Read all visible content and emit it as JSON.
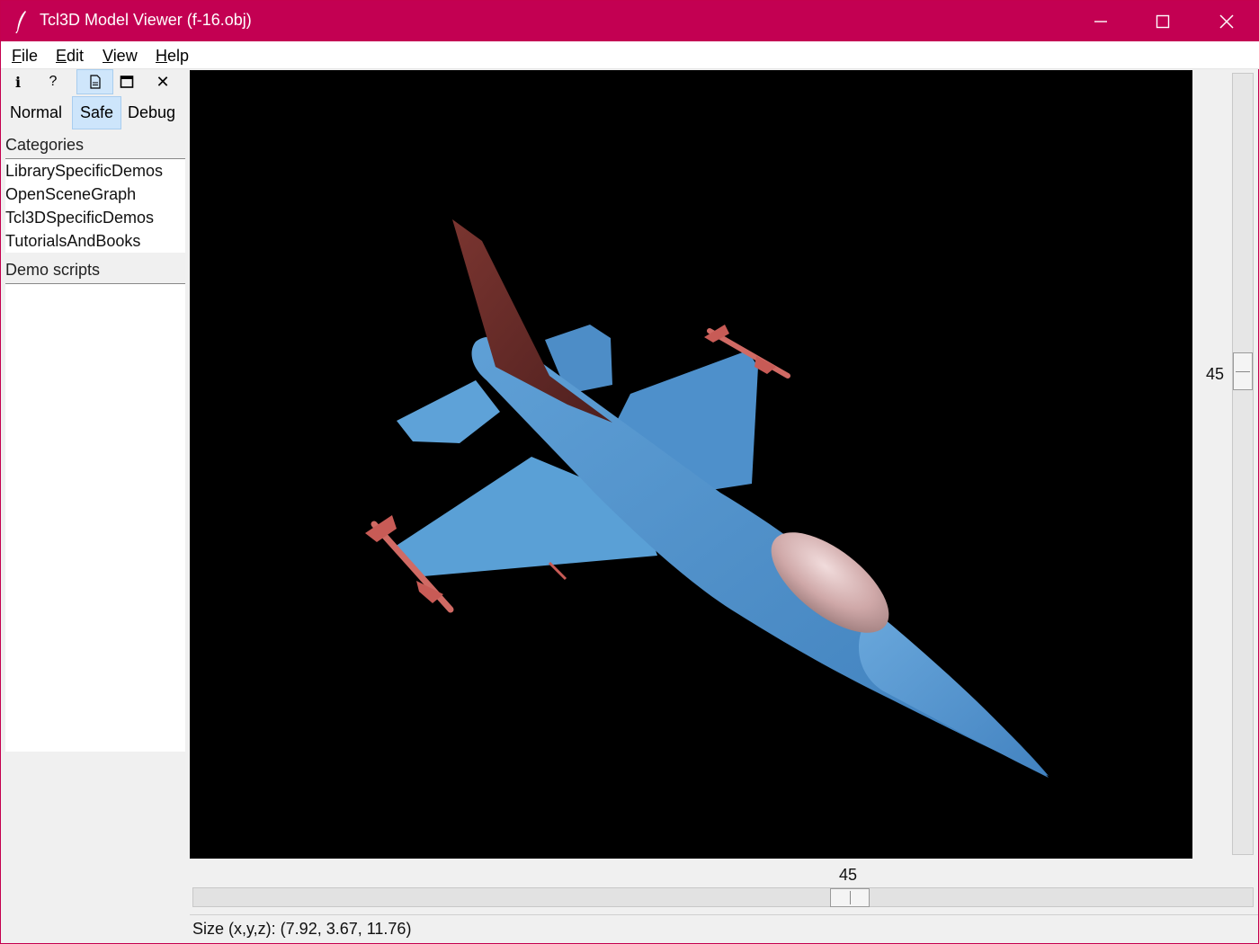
{
  "window": {
    "title": "Tcl3D Model Viewer (f-16.obj)",
    "titlebar_color": "#c30052"
  },
  "menu": [
    {
      "label": "File"
    },
    {
      "label": "Edit"
    },
    {
      "label": "View"
    },
    {
      "label": "Help"
    }
  ],
  "toolbar": {
    "icons": [
      "info-icon",
      "help-icon",
      "document-icon",
      "maximize-view-icon",
      "close-icon"
    ],
    "info_glyph": "i",
    "help_glyph": "?",
    "close_glyph": "✕"
  },
  "modes": [
    "Normal",
    "Safe",
    "Debug"
  ],
  "active_mode": "Safe",
  "categories_header": "Categories",
  "categories": [
    "LibrarySpecificDemos",
    "OpenSceneGraph",
    "Tcl3DSpecificDemos",
    "TutorialsAndBooks"
  ],
  "demo_scripts_header": "Demo scripts",
  "demo_scripts": [],
  "sliders": {
    "vertical_value": "45",
    "horizontal_value": "45"
  },
  "status": {
    "text": "Size (x,y,z): (7.92, 3.67, 11.76)"
  }
}
